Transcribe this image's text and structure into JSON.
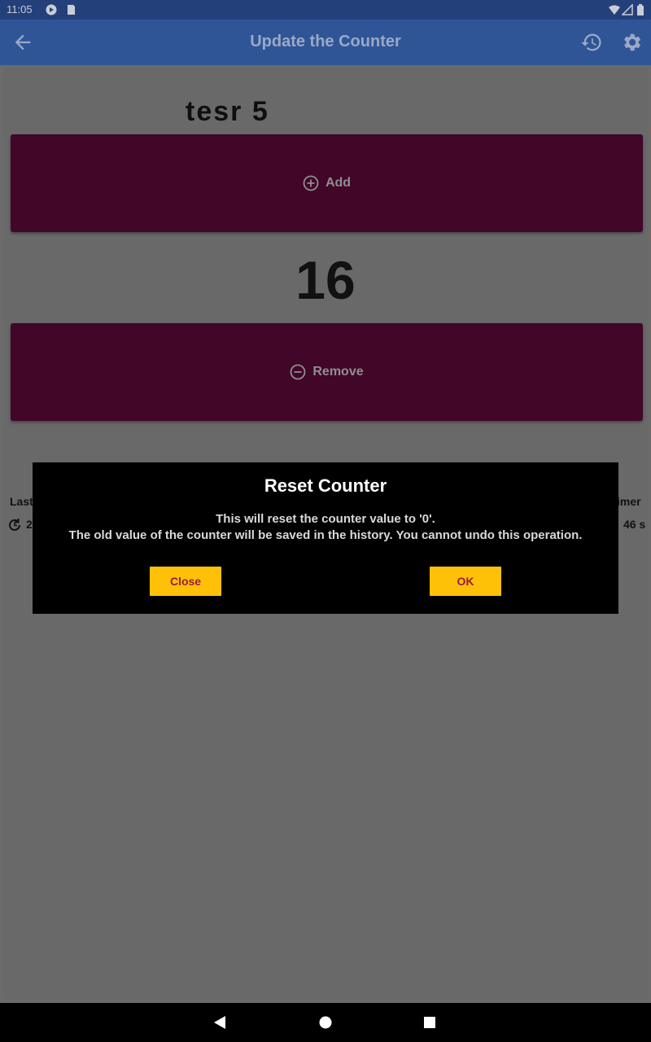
{
  "status_bar": {
    "time": "11:05",
    "icons": [
      "play-protect-icon",
      "sd-card-icon",
      "wifi-icon",
      "signal-icon",
      "battery-icon"
    ]
  },
  "app_bar": {
    "title": "Update the Counter",
    "back_icon": "arrow-back-icon",
    "history_icon": "history-icon",
    "settings_icon": "gear-icon",
    "color": "#2f5597"
  },
  "counter": {
    "name": "tesr 5",
    "value": "16",
    "add_label": "Add",
    "remove_label": "Remove",
    "button_color": "#410628"
  },
  "stats": {
    "left_label": "Last",
    "left_value": "2",
    "right_label": "imer",
    "right_value": "46 s"
  },
  "dialog": {
    "title": "Reset Counter",
    "message_line1": "This will reset the counter value to '0'.",
    "message_line2": "The old value of the counter will be saved in the history. You cannot undo this operation.",
    "close_label": "Close",
    "ok_label": "OK",
    "button_color": "#ffc107"
  },
  "nav_bar": {
    "icons": [
      "back-triangle-icon",
      "home-circle-icon",
      "recents-square-icon"
    ]
  }
}
